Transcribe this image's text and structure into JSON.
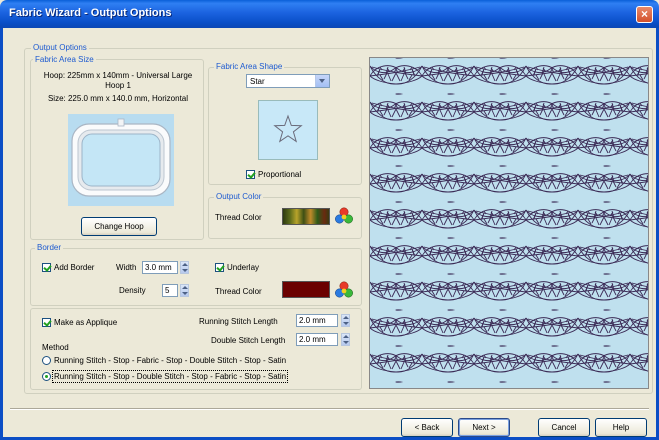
{
  "window": {
    "title": "Fabric Wizard - Output Options",
    "close_glyph": "×"
  },
  "output_options": {
    "label": "Output Options",
    "fabric_area_size": {
      "label": "Fabric Area Size",
      "hoop_line1": "Hoop: 225mm x 140mm - Universal Large",
      "hoop_line2": "Hoop 1",
      "size_line": "Size: 225.0 mm x 140.0 mm, Horizontal",
      "change_hoop_label": "Change Hoop"
    },
    "fabric_area_shape": {
      "label": "Fabric Area Shape",
      "shape_value": "Star",
      "proportional_label": "Proportional",
      "proportional_checked": true
    },
    "output_color": {
      "label": "Output Color",
      "thread_color_label": "Thread Color"
    },
    "border": {
      "label": "Border",
      "add_border_label": "Add Border",
      "add_border_checked": true,
      "width_label": "Width",
      "width_value": "3.0 mm",
      "density_label": "Density",
      "density_value": "5",
      "underlay_label": "Underlay",
      "underlay_checked": true,
      "thread_color_label": "Thread Color",
      "thread_color": "#6b0000"
    },
    "applique": {
      "make_as_applique_label": "Make as Applique",
      "make_as_applique_checked": true,
      "running_stitch_length_label": "Running Stitch Length",
      "running_stitch_length_value": "2.0 mm",
      "double_stitch_length_label": "Double Stitch Length",
      "double_stitch_length_value": "2.0 mm",
      "method_label": "Method",
      "method_options": [
        "Running Stitch - Stop - Fabric - Stop - Double Stitch - Stop - Satin",
        "Running Stitch - Stop - Double Stitch - Stop - Fabric - Stop - Satin"
      ],
      "selected_method": 1
    }
  },
  "buttons": {
    "back": "< Back",
    "next": "Next >",
    "cancel": "Cancel",
    "help": "Help"
  },
  "colors": {
    "accent_blue": "#0b4ec5",
    "preview_bg": "#bfe0ee",
    "leaf_stroke": "#3a2a55",
    "group_label": "#1d5ad0"
  },
  "icons": [
    "close-icon",
    "hoop-icon",
    "star-shape-icon",
    "thread-color-swatch",
    "color-wheel-icon",
    "leaf-pattern-preview"
  ]
}
